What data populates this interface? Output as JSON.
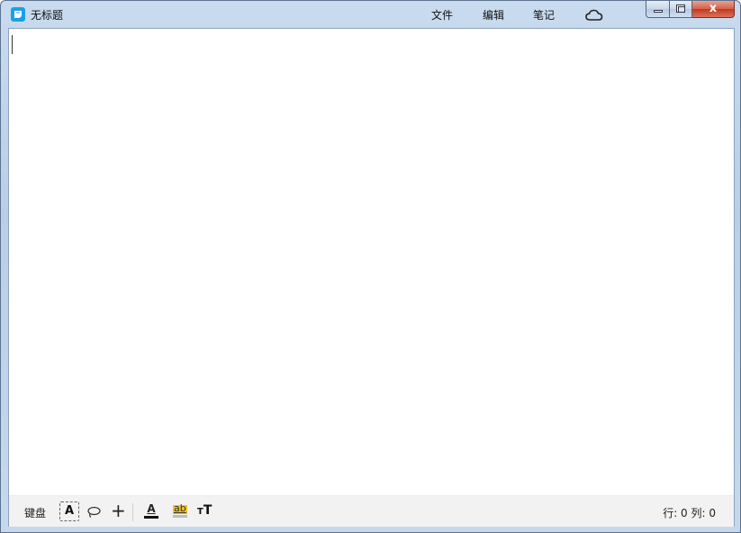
{
  "window": {
    "title": "无标题",
    "app_icon": "notes-app-icon",
    "accent": "#1aa0e8"
  },
  "menu": {
    "file": "文件",
    "edit": "编辑",
    "notes": "笔记",
    "cloud_icon": "cloud-icon"
  },
  "window_controls": {
    "minimize_icon": "minimize-icon",
    "maximize_icon": "maximize-icon",
    "close_icon": "close-icon",
    "close_symbol": "x"
  },
  "editor": {
    "content": ""
  },
  "statusbar": {
    "keyboard_label": "键盘",
    "text_mode_label": "A",
    "lasso_icon": "lasso-icon",
    "add_label": "+",
    "font_color_label": "A",
    "highlight_label": "ab",
    "highlight_color": "#f3c21b",
    "font_size_small": "T",
    "font_size_big": "T",
    "position": "行: 0 列: 0"
  }
}
